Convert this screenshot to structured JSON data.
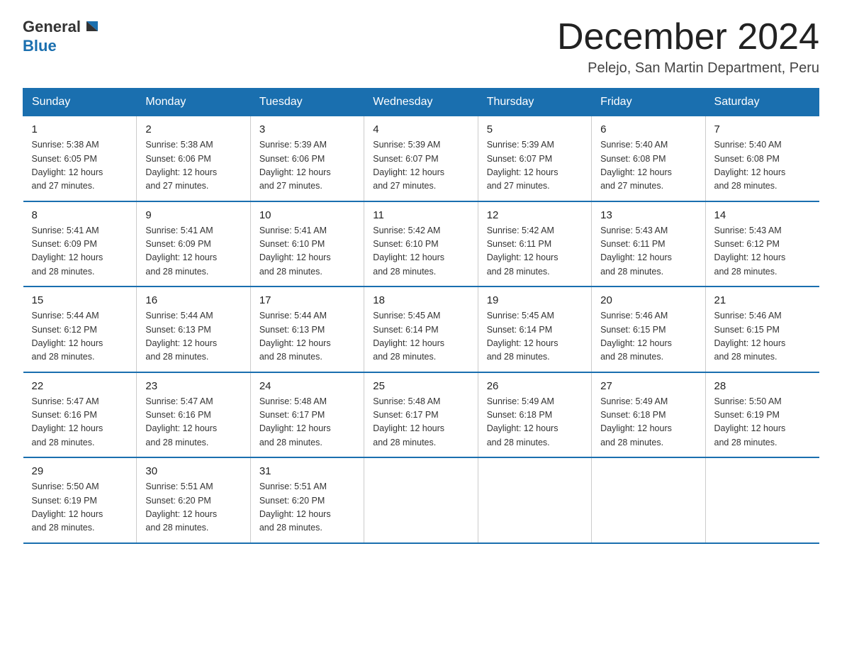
{
  "logo": {
    "general": "General",
    "blue": "Blue"
  },
  "title": "December 2024",
  "location": "Pelejo, San Martin Department, Peru",
  "days_of_week": [
    "Sunday",
    "Monday",
    "Tuesday",
    "Wednesday",
    "Thursday",
    "Friday",
    "Saturday"
  ],
  "weeks": [
    [
      {
        "day": "1",
        "sunrise": "5:38 AM",
        "sunset": "6:05 PM",
        "daylight": "12 hours and 27 minutes."
      },
      {
        "day": "2",
        "sunrise": "5:38 AM",
        "sunset": "6:06 PM",
        "daylight": "12 hours and 27 minutes."
      },
      {
        "day": "3",
        "sunrise": "5:39 AM",
        "sunset": "6:06 PM",
        "daylight": "12 hours and 27 minutes."
      },
      {
        "day": "4",
        "sunrise": "5:39 AM",
        "sunset": "6:07 PM",
        "daylight": "12 hours and 27 minutes."
      },
      {
        "day": "5",
        "sunrise": "5:39 AM",
        "sunset": "6:07 PM",
        "daylight": "12 hours and 27 minutes."
      },
      {
        "day": "6",
        "sunrise": "5:40 AM",
        "sunset": "6:08 PM",
        "daylight": "12 hours and 27 minutes."
      },
      {
        "day": "7",
        "sunrise": "5:40 AM",
        "sunset": "6:08 PM",
        "daylight": "12 hours and 28 minutes."
      }
    ],
    [
      {
        "day": "8",
        "sunrise": "5:41 AM",
        "sunset": "6:09 PM",
        "daylight": "12 hours and 28 minutes."
      },
      {
        "day": "9",
        "sunrise": "5:41 AM",
        "sunset": "6:09 PM",
        "daylight": "12 hours and 28 minutes."
      },
      {
        "day": "10",
        "sunrise": "5:41 AM",
        "sunset": "6:10 PM",
        "daylight": "12 hours and 28 minutes."
      },
      {
        "day": "11",
        "sunrise": "5:42 AM",
        "sunset": "6:10 PM",
        "daylight": "12 hours and 28 minutes."
      },
      {
        "day": "12",
        "sunrise": "5:42 AM",
        "sunset": "6:11 PM",
        "daylight": "12 hours and 28 minutes."
      },
      {
        "day": "13",
        "sunrise": "5:43 AM",
        "sunset": "6:11 PM",
        "daylight": "12 hours and 28 minutes."
      },
      {
        "day": "14",
        "sunrise": "5:43 AM",
        "sunset": "6:12 PM",
        "daylight": "12 hours and 28 minutes."
      }
    ],
    [
      {
        "day": "15",
        "sunrise": "5:44 AM",
        "sunset": "6:12 PM",
        "daylight": "12 hours and 28 minutes."
      },
      {
        "day": "16",
        "sunrise": "5:44 AM",
        "sunset": "6:13 PM",
        "daylight": "12 hours and 28 minutes."
      },
      {
        "day": "17",
        "sunrise": "5:44 AM",
        "sunset": "6:13 PM",
        "daylight": "12 hours and 28 minutes."
      },
      {
        "day": "18",
        "sunrise": "5:45 AM",
        "sunset": "6:14 PM",
        "daylight": "12 hours and 28 minutes."
      },
      {
        "day": "19",
        "sunrise": "5:45 AM",
        "sunset": "6:14 PM",
        "daylight": "12 hours and 28 minutes."
      },
      {
        "day": "20",
        "sunrise": "5:46 AM",
        "sunset": "6:15 PM",
        "daylight": "12 hours and 28 minutes."
      },
      {
        "day": "21",
        "sunrise": "5:46 AM",
        "sunset": "6:15 PM",
        "daylight": "12 hours and 28 minutes."
      }
    ],
    [
      {
        "day": "22",
        "sunrise": "5:47 AM",
        "sunset": "6:16 PM",
        "daylight": "12 hours and 28 minutes."
      },
      {
        "day": "23",
        "sunrise": "5:47 AM",
        "sunset": "6:16 PM",
        "daylight": "12 hours and 28 minutes."
      },
      {
        "day": "24",
        "sunrise": "5:48 AM",
        "sunset": "6:17 PM",
        "daylight": "12 hours and 28 minutes."
      },
      {
        "day": "25",
        "sunrise": "5:48 AM",
        "sunset": "6:17 PM",
        "daylight": "12 hours and 28 minutes."
      },
      {
        "day": "26",
        "sunrise": "5:49 AM",
        "sunset": "6:18 PM",
        "daylight": "12 hours and 28 minutes."
      },
      {
        "day": "27",
        "sunrise": "5:49 AM",
        "sunset": "6:18 PM",
        "daylight": "12 hours and 28 minutes."
      },
      {
        "day": "28",
        "sunrise": "5:50 AM",
        "sunset": "6:19 PM",
        "daylight": "12 hours and 28 minutes."
      }
    ],
    [
      {
        "day": "29",
        "sunrise": "5:50 AM",
        "sunset": "6:19 PM",
        "daylight": "12 hours and 28 minutes."
      },
      {
        "day": "30",
        "sunrise": "5:51 AM",
        "sunset": "6:20 PM",
        "daylight": "12 hours and 28 minutes."
      },
      {
        "day": "31",
        "sunrise": "5:51 AM",
        "sunset": "6:20 PM",
        "daylight": "12 hours and 28 minutes."
      },
      null,
      null,
      null,
      null
    ]
  ],
  "labels": {
    "sunrise": "Sunrise:",
    "sunset": "Sunset:",
    "daylight": "Daylight:"
  },
  "colors": {
    "header_bg": "#1a6faf",
    "header_text": "#ffffff",
    "border": "#1a6faf"
  }
}
